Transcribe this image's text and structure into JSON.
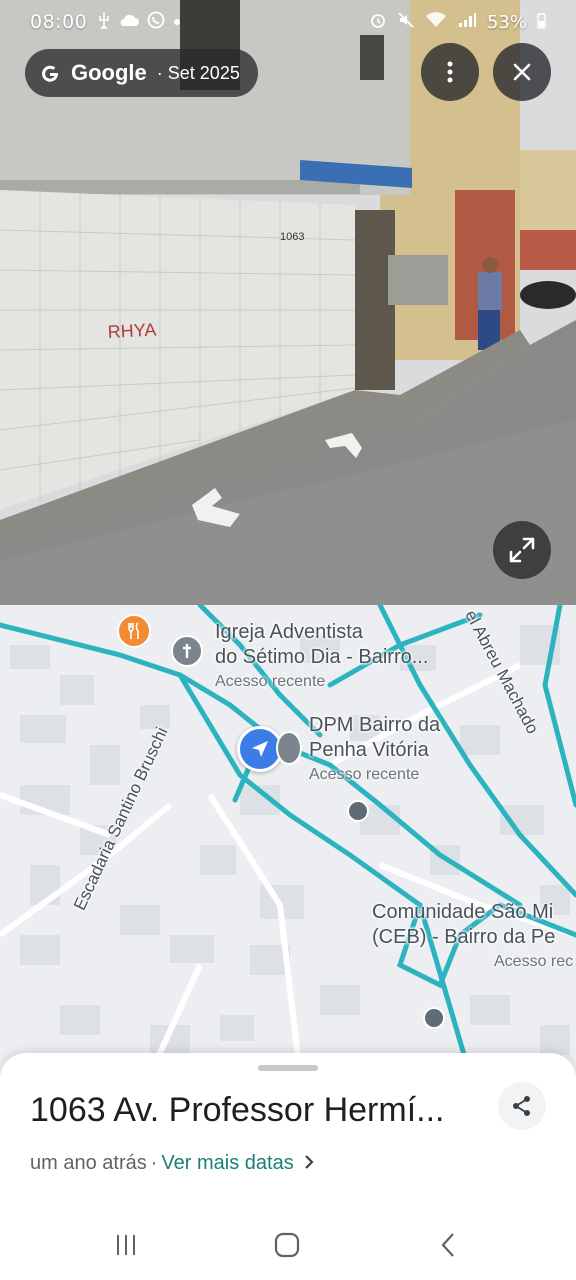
{
  "status_bar": {
    "time": "08:00",
    "battery": "53%",
    "left_icons": [
      "usb-icon",
      "cloud-icon",
      "whatsapp-icon",
      "dot-icon"
    ],
    "right_icons": [
      "alarm-icon",
      "mute-icon",
      "wifi-icon",
      "signal-icon",
      "battery-icon"
    ]
  },
  "street_view": {
    "brand": "Google",
    "date": "· Set 2025",
    "house_number": "1063",
    "graffiti": "RHYA"
  },
  "map": {
    "places": [
      {
        "name_line1": "Igreja Adventista",
        "name_line2": "do Sétimo Dia - Bairro...",
        "sub": "Acesso recente"
      },
      {
        "name_line1": "DPM Bairro da",
        "name_line2": "Penha Vitória",
        "sub": "Acesso recente"
      },
      {
        "name_line1": "Comunidade São Mi",
        "name_line2": "(CEB) - Bairro da Pe",
        "sub": "Acesso rec"
      }
    ],
    "streets": [
      "Escadaria Santino Bruschi",
      "el Abreu Machado"
    ]
  },
  "sheet": {
    "address": "1063 Av. Professor Hermí...",
    "time_ago": "um ano atrás",
    "separator": "·",
    "link": "Ver mais datas"
  },
  "colors": {
    "route": "#2bb3c0",
    "link": "#1a7f76",
    "location_blue": "#3b7ce6",
    "restaurant_orange": "#f28b33"
  }
}
